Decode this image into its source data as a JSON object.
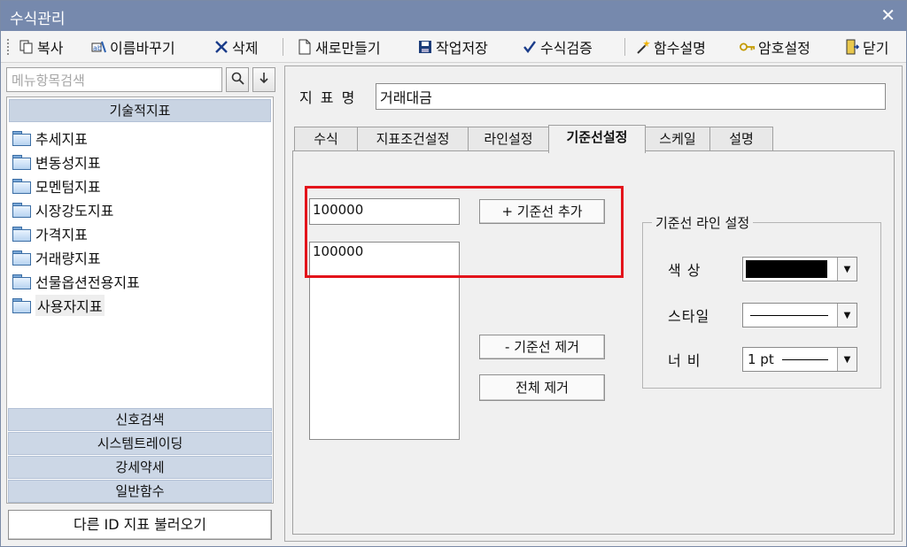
{
  "window": {
    "title": "수식관리",
    "close_glyph": "✕"
  },
  "toolbar": {
    "copy": "복사",
    "rename": "이름바꾸기",
    "delete": "삭제",
    "new": "새로만들기",
    "save": "작업저장",
    "verify": "수식검증",
    "func_help": "함수설명",
    "password": "암호설정",
    "close": "닫기"
  },
  "sidebar": {
    "search_placeholder": "메뉴항목검색",
    "technical_header": "기술적지표",
    "items": [
      "추세지표",
      "변동성지표",
      "모멘텀지표",
      "시장강도지표",
      "가격지표",
      "거래량지표",
      "선물옵션전용지표",
      "사용자지표"
    ],
    "selected_index": 7,
    "bottom_groups": [
      "신호검색",
      "시스템트레이딩",
      "강세약세",
      "일반함수"
    ],
    "load_button": "다른 ID 지표 불러오기"
  },
  "main": {
    "indicator_label": "지 표 명",
    "indicator_name": "거래대금",
    "tabs": [
      "수식",
      "지표조건설정",
      "라인설정",
      "기준선설정",
      "스케일",
      "설명"
    ],
    "active_tab_index": 3,
    "baseline": {
      "input_value": "100000",
      "list_items": [
        "100000"
      ],
      "add_button": "+ 기준선 추가",
      "remove_button": "- 기준선 제거",
      "clear_button": "전체 제거"
    },
    "line_settings": {
      "title": "기준선 라인 설정",
      "color_label": "색    상",
      "color_value": "#000000",
      "style_label": "스타일",
      "width_label": "너    비",
      "width_value": "1 pt"
    }
  },
  "highlight_color": "#e3141b"
}
